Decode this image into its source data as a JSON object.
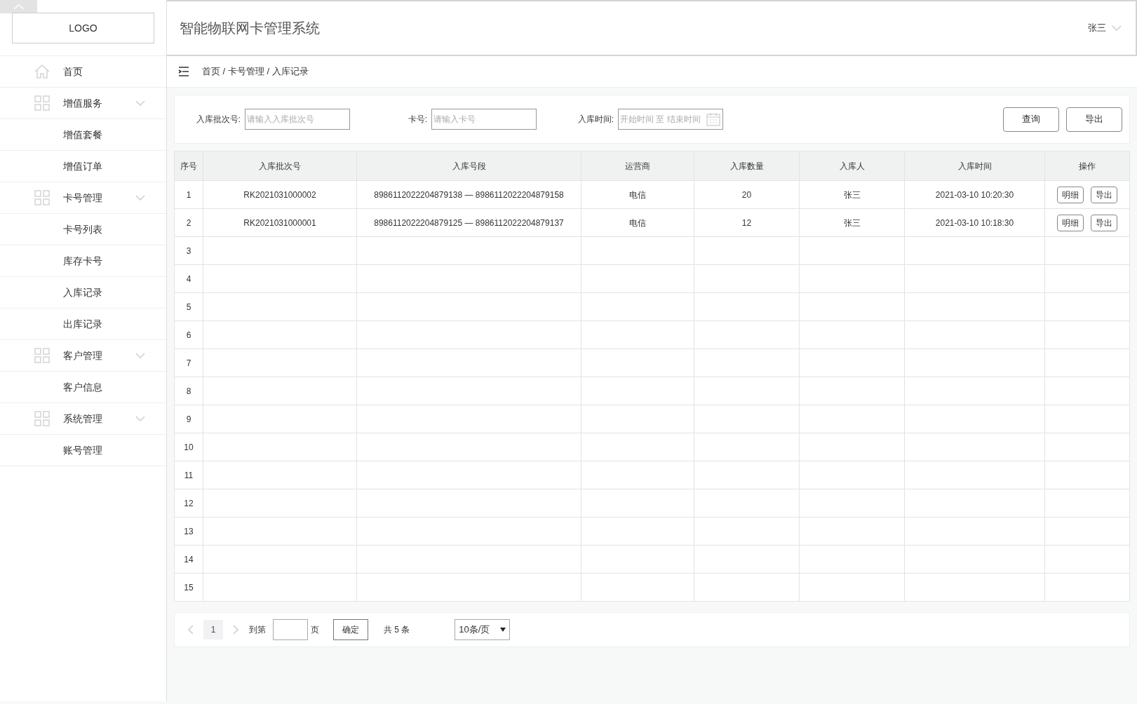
{
  "sidebar": {
    "logo": "LOGO",
    "items": [
      {
        "label": "首页",
        "kind": "link"
      },
      {
        "label": "增值服务",
        "kind": "group",
        "expanded": true,
        "children": [
          {
            "label": "增值套餐"
          },
          {
            "label": "增值订单"
          }
        ]
      },
      {
        "label": "卡号管理",
        "kind": "group",
        "expanded": true,
        "children": [
          {
            "label": "卡号列表"
          },
          {
            "label": "库存卡号"
          },
          {
            "label": "入库记录"
          },
          {
            "label": "出库记录"
          }
        ]
      },
      {
        "label": "客户管理",
        "kind": "group",
        "expanded": true,
        "children": [
          {
            "label": "客户信息"
          }
        ]
      },
      {
        "label": "系统管理",
        "kind": "group",
        "expanded": true,
        "children": [
          {
            "label": "账号管理"
          }
        ]
      }
    ]
  },
  "header": {
    "title": "智能物联网卡管理系统",
    "user": "张三"
  },
  "breadcrumb": "首页 / 卡号管理 / 入库记录",
  "filters": [
    {
      "label": "入库批次号:",
      "placeholder": "请输入入库批次号",
      "kind": "text"
    },
    {
      "label": "卡号:",
      "placeholder": "请输入卡号",
      "kind": "text"
    },
    {
      "label": "入库时间:",
      "placeholder": "开始时间 至 结束时间",
      "kind": "date"
    }
  ],
  "actions": [
    "查询",
    "导出"
  ],
  "table": {
    "columns": [
      "序号",
      "入库批次号",
      "入库号段",
      "运营商",
      "入库数量",
      "入库人",
      "入库时间",
      "操作"
    ],
    "rows": [
      {
        "cells": [
          "1",
          "RK2021031000002",
          "8986112022204879138 — 8986112022204879158",
          "电信",
          "20",
          "张三",
          "2021-03-10 10:20:30"
        ],
        "buttons": [
          "明细",
          "导出"
        ]
      },
      {
        "cells": [
          "2",
          "RK2021031000001",
          "8986112022204879125 — 8986112022204879137",
          "电信",
          "12",
          "张三",
          "2021-03-10 10:18:30"
        ],
        "buttons": [
          "明细",
          "导出"
        ]
      },
      {
        "cells": [
          "3"
        ],
        "buttons": []
      },
      {
        "cells": [
          "4"
        ],
        "buttons": []
      },
      {
        "cells": [
          "5"
        ],
        "buttons": []
      },
      {
        "cells": [
          "6"
        ],
        "buttons": []
      },
      {
        "cells": [
          "7"
        ],
        "buttons": []
      },
      {
        "cells": [
          "8"
        ],
        "buttons": []
      },
      {
        "cells": [
          "9"
        ],
        "buttons": []
      },
      {
        "cells": [
          "10"
        ],
        "buttons": []
      },
      {
        "cells": [
          "11"
        ],
        "buttons": []
      },
      {
        "cells": [
          "12"
        ],
        "buttons": []
      },
      {
        "cells": [
          "13"
        ],
        "buttons": []
      },
      {
        "cells": [
          "14"
        ],
        "buttons": []
      },
      {
        "cells": [
          "15"
        ],
        "buttons": []
      }
    ]
  },
  "pagination": {
    "pages": [
      {
        "label": "1",
        "selected": true
      }
    ],
    "goto_label": "到第",
    "page_suffix": "页",
    "confirm": "确定",
    "total": "共 5 条",
    "page_size": "10条/页"
  }
}
